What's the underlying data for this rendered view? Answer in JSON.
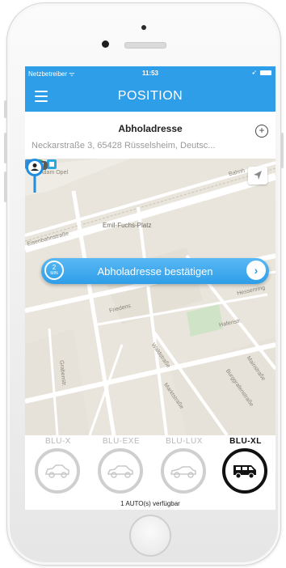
{
  "status_bar": {
    "carrier": "Netzbetreiber ᯤ",
    "time": "11:53",
    "location_symbol": "➶"
  },
  "nav": {
    "title": "POSITION",
    "menu_icon": "hamburger-menu-icon"
  },
  "address": {
    "label": "Abholadresse",
    "value": "Neckarstraße 3, 65428 Rüsselsheim, Deutsc..."
  },
  "map": {
    "street_labels": [
      "Adam Opel",
      "Bahnh",
      "Eisenbahnstraße",
      "Emil-Fuchs-Platz",
      "Friedens",
      "Grabenstr.",
      "Hessenring",
      "Waldstraße",
      "Hafenstr.",
      "Marktstraße",
      "Burggrafenstraße",
      "Mainstraße"
    ],
    "confirm": {
      "eta_value": "2",
      "eta_unit": "MIN",
      "label": "Abholadresse bestätigen",
      "arrow": "›"
    }
  },
  "vehicles": [
    {
      "label": "BLU-X",
      "selected": false,
      "icon": "sedan-car-icon"
    },
    {
      "label": "BLU-EXE",
      "selected": false,
      "icon": "business-car-icon"
    },
    {
      "label": "BLU-LUX",
      "selected": false,
      "icon": "luxury-car-icon"
    },
    {
      "label": "BLU-XL",
      "selected": true,
      "icon": "van-icon"
    }
  ],
  "availability": "1 AUTO(s) verfügbar",
  "colors": {
    "accent": "#2f9ee8",
    "selected_border": "#111111",
    "unselected_border": "#cfcfcf"
  }
}
